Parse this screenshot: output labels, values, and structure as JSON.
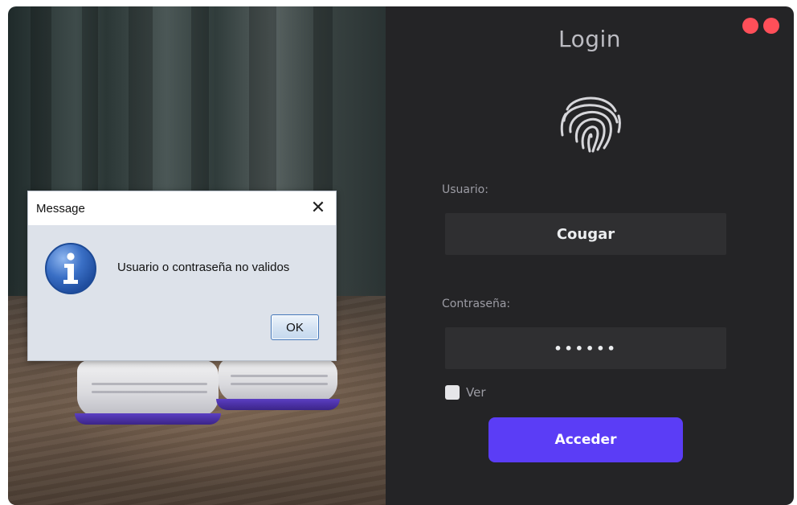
{
  "login_window": {
    "title": "Login",
    "user_label": "Usuario:",
    "user_value": "Cougar",
    "password_label": "Contraseña:",
    "password_value": "••••••",
    "show_checkbox_label": "Ver",
    "submit_label": "Acceder",
    "accent_color": "#5b3df6",
    "window_control_color": "#ff4f59",
    "icon": "fingerprint-icon"
  },
  "dialog": {
    "title": "Message",
    "close_symbol": "✕",
    "message": "Usuario o contraseña no validos",
    "ok_label": "OK",
    "icon": "info-icon"
  }
}
